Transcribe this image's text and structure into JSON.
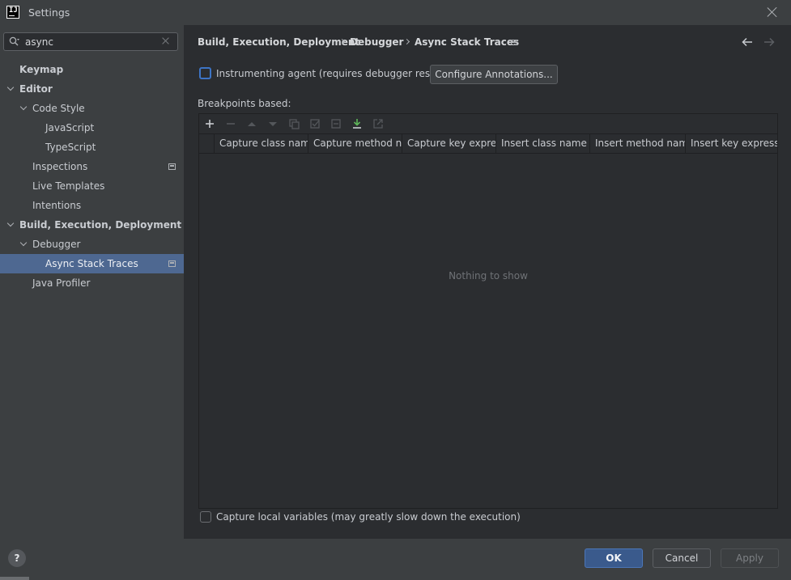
{
  "window": {
    "title": "Settings"
  },
  "search": {
    "value": "async"
  },
  "sidebar": {
    "items": [
      {
        "label": "Keymap",
        "level": 0,
        "bold": true,
        "chevron": false,
        "project_icon": false,
        "selected": false
      },
      {
        "label": "Editor",
        "level": 0,
        "bold": true,
        "chevron": true,
        "project_icon": false,
        "selected": false
      },
      {
        "label": "Code Style",
        "level": 1,
        "bold": false,
        "chevron": true,
        "project_icon": false,
        "selected": false
      },
      {
        "label": "JavaScript",
        "level": 2,
        "bold": false,
        "chevron": false,
        "project_icon": false,
        "selected": false
      },
      {
        "label": "TypeScript",
        "level": 2,
        "bold": false,
        "chevron": false,
        "project_icon": false,
        "selected": false
      },
      {
        "label": "Inspections",
        "level": 1,
        "bold": false,
        "chevron": false,
        "project_icon": true,
        "selected": false
      },
      {
        "label": "Live Templates",
        "level": 1,
        "bold": false,
        "chevron": false,
        "project_icon": false,
        "selected": false
      },
      {
        "label": "Intentions",
        "level": 1,
        "bold": false,
        "chevron": false,
        "project_icon": false,
        "selected": false
      },
      {
        "label": "Build, Execution, Deployment",
        "level": 0,
        "bold": true,
        "chevron": true,
        "project_icon": false,
        "selected": false
      },
      {
        "label": "Debugger",
        "level": 1,
        "bold": false,
        "chevron": true,
        "project_icon": false,
        "selected": false
      },
      {
        "label": "Async Stack Traces",
        "level": 2,
        "bold": false,
        "chevron": false,
        "project_icon": true,
        "selected": true
      },
      {
        "label": "Java Profiler",
        "level": 1,
        "bold": false,
        "chevron": false,
        "project_icon": false,
        "selected": false
      }
    ]
  },
  "breadcrumb": {
    "items": [
      "Build, Execution, Deployment",
      "Debugger",
      "Async Stack Traces"
    ]
  },
  "content": {
    "agent_label": "Instrumenting agent (requires debugger restart)",
    "agent_checked": false,
    "configure_label": "Configure Annotations...",
    "breakpoints_label": "Breakpoints based:",
    "columns": [
      "Capture class name",
      "Capture method n...",
      "Capture key expre...",
      "Insert class name",
      "Insert method name",
      "Insert key expressi..."
    ],
    "empty_text": "Nothing to show",
    "locals_label": "Capture local variables (may greatly slow down the execution)",
    "locals_checked": false
  },
  "toolbar_icons": [
    "add-icon",
    "remove-icon",
    "move-up-icon",
    "move-down-icon",
    "copy-icon",
    "enable-icon",
    "disable-icon",
    "import-icon",
    "export-icon"
  ],
  "footer": {
    "help_label": "?",
    "ok_label": "OK",
    "cancel_label": "Cancel",
    "apply_label": "Apply"
  },
  "colors": {
    "accent": "#4e6891",
    "ok_button": "#3a5a8c",
    "checkbox_focus": "#3d74c5",
    "import_icon": "#5fb85a"
  }
}
